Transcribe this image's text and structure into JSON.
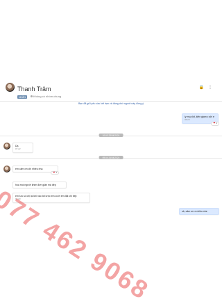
{
  "header": {
    "name": "Thanh Trâm",
    "tag": "NHÃN",
    "status": "Không có nhóm chung"
  },
  "notice": "Bạn đã gửi yêu cầu kết bạn và đang chờ người này đồng ý",
  "date_divider_1": "10:03 23/04/2024",
  "date_divider_2": "09:04 24/04/2024",
  "messages": [
    {
      "text": "ly mua kit, kiến giam c ahi e",
      "time": "06:23",
      "reaction_count": "1"
    },
    {
      "text": "Dạ",
      "time": "07:22"
    },
    {
      "text": "em cảm ơn chị nhiều nha",
      "reaction_count": "1"
    },
    {
      "text": "hoa moi người khen đơn giản mà đẹp"
    },
    {
      "text": "em lưu số chị lại khi nào tốt lược em cười em đặt chị tiếp",
      "time": "06:23"
    },
    {
      "text": "ok, cảm ơn e nhiều nhe"
    }
  ],
  "watermark": "077 462 9068",
  "icons": {
    "avatar": "avatar-icon",
    "tag": "tag-icon",
    "lock": "lock-icon",
    "menu": "menu-icon",
    "heart": "heart-icon"
  }
}
